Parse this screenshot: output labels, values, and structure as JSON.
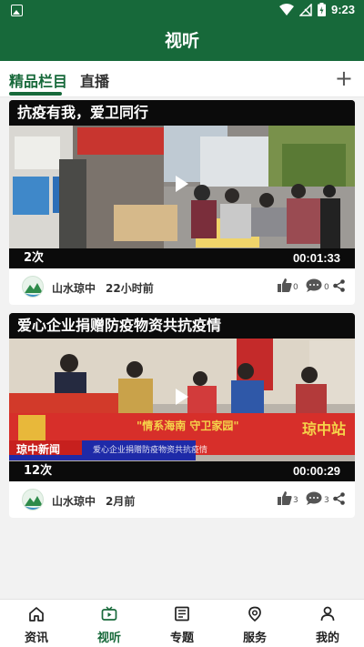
{
  "status_bar": {
    "time": "9:23"
  },
  "app_bar": {
    "title": "视听"
  },
  "tabs": [
    {
      "label": "精品栏目"
    },
    {
      "label": "直播"
    }
  ],
  "videos": [
    {
      "title": "抗疫有我，爱卫同行",
      "views": "2次",
      "duration": "00:01:33",
      "source": "山水琼中",
      "time": "22小时前",
      "likes": "0",
      "comments": "0"
    },
    {
      "title": "爱心企业捐赠防疫物资共抗疫情",
      "views": "12次",
      "duration": "00:00:29",
      "source": "山水琼中",
      "time": "2月前",
      "likes": "3",
      "comments": "3",
      "banner_text": "\"情系海南 守卫家园\"",
      "banner_side_text": "琼中站",
      "news_logo": "琼中新闻",
      "ticker_text": "爱心企业捐赠防疫物资共抗疫情"
    }
  ],
  "bottom_nav": [
    {
      "label": "资讯",
      "icon": "home-icon"
    },
    {
      "label": "视听",
      "icon": "tv-icon"
    },
    {
      "label": "专题",
      "icon": "newspaper-icon"
    },
    {
      "label": "服务",
      "icon": "service-icon"
    },
    {
      "label": "我的",
      "icon": "person-icon"
    }
  ],
  "colors": {
    "primary": "#17693a",
    "background": "#f2f2f2"
  }
}
